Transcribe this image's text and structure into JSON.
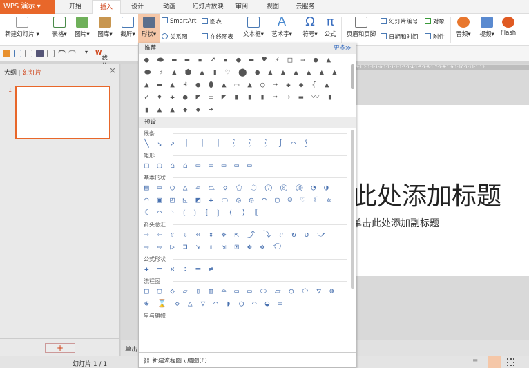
{
  "app": {
    "logo": "WPS 演示",
    "tabs": [
      "开始",
      "插入",
      "设计",
      "动画",
      "幻灯片放映",
      "审阅",
      "视图",
      "云服务"
    ],
    "active_tab": "插入"
  },
  "ribbon": {
    "new_slide": "新建幻灯片",
    "table": "表格",
    "picture": "图片",
    "gallery": "图库",
    "screenshot": "截屏",
    "shape": "形状",
    "smartart": "SmartArt",
    "chart": "图表",
    "relation": "关系图",
    "online_chart": "在线图表",
    "textbox": "文本框",
    "wordart": "艺术字",
    "symbol": "符号",
    "formula": "公式",
    "header_footer": "页眉和页脚",
    "slide_number": "幻灯片编号",
    "object": "对象",
    "datetime": "日期和时间",
    "attachment": "附件",
    "audio": "音频",
    "video": "视频",
    "flash": "Flash"
  },
  "quick": {
    "mywps": "我的WPS"
  },
  "left_panel": {
    "tab_outline": "大纲",
    "tab_slides": "幻灯片",
    "slide_index": "1",
    "add": "+"
  },
  "slide": {
    "title": "此处添加标题",
    "subtitle": "单击此处添加副标题",
    "notes": "单击"
  },
  "ruler": "3·1·2·1·1·1·0·1·1·1·2·1·3·1·4·1·5·1·6·1·7·1·8·1·9·1·10·1·11·1·12",
  "status": {
    "slide_count": "幻灯片 1 / 1"
  },
  "colors": {
    "accent": "#e8672a",
    "preset": "#4a72b0"
  },
  "dropdown": {
    "recommended": "推荐",
    "more": "更多≫",
    "presets": "预设",
    "recommended_shapes": "●⬬▬▬▪➚▪●▬♥⚡□⇒●▲⬬⚡▲⬢▲▮♡⬤●▲▲▲▲▲▲▲▬▲☀●⬮▲▭▲○➞✚◆{▲✓♦✚●◤▭◤▮▮▮➞➔▬〰▮▮▲▲◆◆➔",
    "sections": [
      {
        "label": "线条",
        "shapes": "╲↘↗⎾⎾⎾⌇⌇⌇∫⌓⟆"
      },
      {
        "label": "矩形",
        "shapes": "□▢⌂⌂▭▭▭▭▭"
      },
      {
        "label": "基本形状",
        "shapes": "▤▭○△▱⏢◇⬠⬡⑦⑧⑩◔◑◠▣◰◺◩✚⬭◎◎◠▢☺♡☾✲☾⌓◝⟮⟯⦃⦄⟨⟩⟦"
      },
      {
        "label": "箭头总汇",
        "shapes": "⇨⇦⇧⇩⇔⇕✥⇱⤴⤵⤶↻↺⤻⇨⇨▷⊐⇲⇧⇲⊡✥✥⟲"
      },
      {
        "label": "公式形状",
        "shapes": "✚━✕÷═≠"
      },
      {
        "label": "流程图",
        "shapes": "□▢◇▱▯▥⌓▭▭⬭⏥○⬠▽⊗⊕⌛◇△▽⌓◗◯⌓◒▭"
      },
      {
        "label": "星与旗帜",
        "shapes": ""
      }
    ],
    "new_flowchart": "新建流程图 \\ 脑图(F)"
  }
}
